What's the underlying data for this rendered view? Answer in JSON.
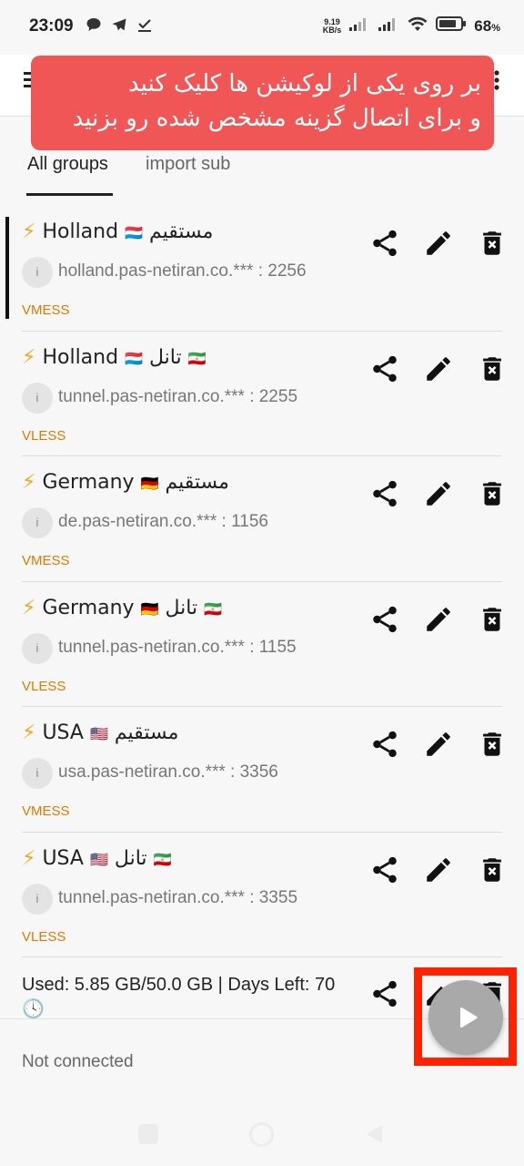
{
  "status_bar": {
    "time": "23:09",
    "net_speed_value": "9.19",
    "net_speed_unit": "KB/s",
    "battery": "68",
    "battery_unit": "%",
    "icons": [
      "chat-icon",
      "telegram-icon",
      "download-done-icon",
      "signal-icon",
      "signal-icon",
      "wifi-icon",
      "battery-icon"
    ]
  },
  "tutorial": {
    "line1": "بر روی یکی از لوکیشن ها کلیک کنید",
    "line2": "و برای اتصال گزینه مشخص شده رو بزنید"
  },
  "tabs": [
    {
      "label": "All groups",
      "selected": true
    },
    {
      "label": "import sub",
      "selected": false
    }
  ],
  "servers": [
    {
      "bolt": "⚡",
      "country": "Holland",
      "flag": "🇱🇺",
      "suffix": "مستقیم",
      "suffix_flag": "",
      "info": "i",
      "address": "holland.pas-netiran.co.*** : 2256",
      "type": "VMESS",
      "selected": true
    },
    {
      "bolt": "⚡",
      "country": "Holland",
      "flag": "🇱🇺",
      "suffix": "تانل",
      "suffix_flag": "🇮🇷",
      "info": "i",
      "address": "tunnel.pas-netiran.co.*** : 2255",
      "type": "VLESS",
      "selected": false
    },
    {
      "bolt": "⚡",
      "country": "Germany",
      "flag": "🇩🇪",
      "suffix": "مستقیم",
      "suffix_flag": "",
      "info": "i",
      "address": "de.pas-netiran.co.*** : 1156",
      "type": "VMESS",
      "selected": false
    },
    {
      "bolt": "⚡",
      "country": "Germany",
      "flag": "🇩🇪",
      "suffix": "تانل",
      "suffix_flag": "🇮🇷",
      "info": "i",
      "address": "tunnel.pas-netiran.co.*** : 1155",
      "type": "VLESS",
      "selected": false
    },
    {
      "bolt": "⚡",
      "country": "USA",
      "flag": "🇺🇸",
      "suffix": "مستقیم",
      "suffix_flag": "",
      "info": "i",
      "address": "usa.pas-netiran.co.*** : 3356",
      "type": "VMESS",
      "selected": false
    },
    {
      "bolt": "⚡",
      "country": "USA",
      "flag": "🇺🇸",
      "suffix": "تانل",
      "suffix_flag": "🇮🇷",
      "info": "i",
      "address": "tunnel.pas-netiran.co.*** : 3355",
      "type": "VLESS",
      "selected": false
    }
  ],
  "usage": {
    "text": "Used: 5.85 GB/50.0 GB | Days Left: 70",
    "clock": "🕓"
  },
  "connection": {
    "status": "Not connected"
  },
  "fab": {
    "icon": "play-icon",
    "highlight_color": "#ff2200"
  },
  "colors": {
    "accent_banner": "#f05656",
    "type_label": "#e07b00",
    "bolt": "#f5a623"
  }
}
